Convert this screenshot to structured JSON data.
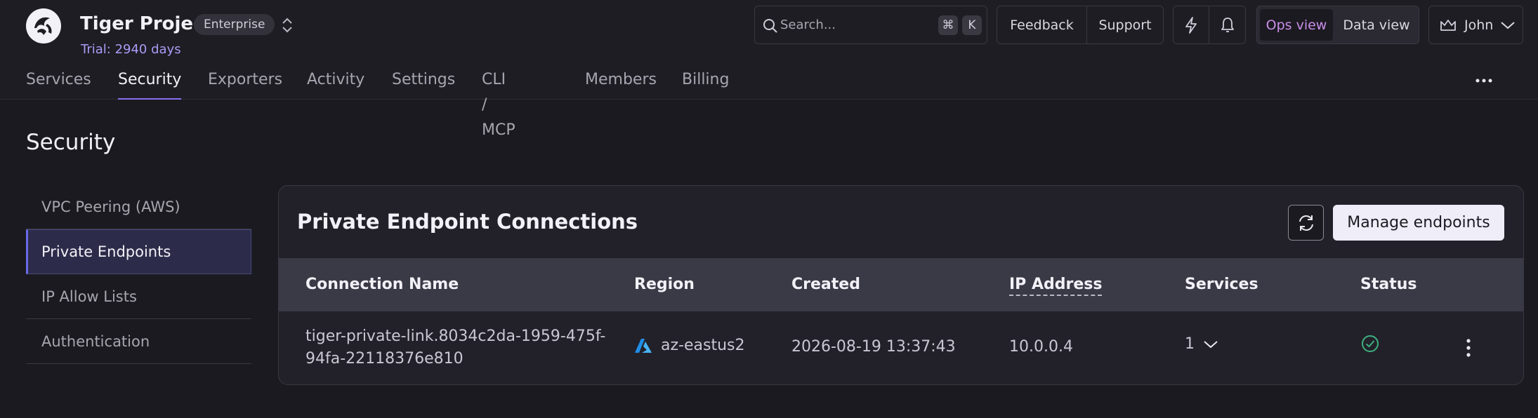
{
  "header": {
    "project_title": "Tiger Project",
    "plan_badge": "Enterprise",
    "trial_text": "Trial: 2940 days"
  },
  "search": {
    "placeholder": "Search...",
    "shortcut_keys": [
      "⌘",
      "K"
    ]
  },
  "top_actions": {
    "feedback": "Feedback",
    "support": "Support"
  },
  "view_toggle": {
    "options": [
      "Ops view",
      "Data view"
    ],
    "selected": "Ops view"
  },
  "user": {
    "name": "John"
  },
  "nav": {
    "tabs": [
      "Services",
      "Security",
      "Exporters",
      "Activity",
      "Settings",
      "CLI / MCP",
      "Members",
      "Billing"
    ],
    "active": "Security"
  },
  "page": {
    "title": "Security"
  },
  "subnav": {
    "items": [
      "VPC Peering (AWS)",
      "Private Endpoints",
      "IP Allow Lists",
      "Authentication"
    ],
    "active": "Private Endpoints"
  },
  "panel": {
    "title": "Private Endpoint Connections",
    "manage_label": "Manage endpoints",
    "columns": [
      "Connection Name",
      "Region",
      "Created",
      "IP Address",
      "Services",
      "Status"
    ],
    "rows": [
      {
        "connection_name": "tiger-private-link.8034c2da-1959-475f-94fa-22118376e810",
        "region": "az-eastus2",
        "created": "2026-08-19 13:37:43",
        "ip_address": "10.0.0.4",
        "services": "1",
        "status": "check-circle-icon"
      }
    ]
  },
  "colors": {
    "accent_purple": "#8b6ff0",
    "ops_view_pink": "#c98ee8",
    "trial_text": "#a99cf5",
    "status_green": "#3fb27f",
    "azure_blue": "#1f8fe8"
  }
}
